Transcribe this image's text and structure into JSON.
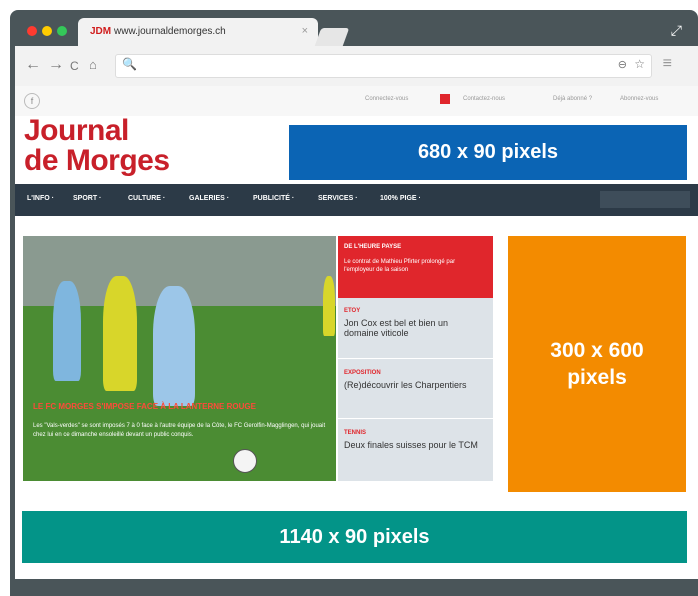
{
  "browser": {
    "tab": {
      "site_abbr": "JDM",
      "url_text": "www.journaldemorges.ch",
      "close": "×"
    },
    "nav": {
      "back": "←",
      "forward": "→",
      "reload": "C",
      "home": "⌂"
    },
    "address": {
      "search_icon": "🔍",
      "zoom_icon": "⊖",
      "star_icon": "☆"
    },
    "menu_icon": "≡",
    "expand_icon": "⤢",
    "traffic_lights": [
      "#ff3b30",
      "#ffcc00",
      "#34c759"
    ]
  },
  "site": {
    "top_links": [
      "Connectez-vous",
      "Contactez-nous",
      "Déjà abonné ?",
      "Abonnez-vous"
    ],
    "logo_line1": "Journal",
    "logo_line2": "de Morges",
    "nav_items": [
      "L'INFO ·",
      "SPORT ·",
      "CULTURE ·",
      "GALERIES ·",
      "PUBLICITÉ ·",
      "SERVICES ·",
      "100% PIGE ·"
    ],
    "hero": {
      "title": "LE FC MORGES S'IMPOSE FACE À LA LANTERNE ROUGE",
      "text": "Les \"Vals-verdes\" se sont imposés 7 à 0 face à l'autre équipe de la Côte, le FC Gerolfin-Magglingen, qui jouait chez lui en ce dimanche ensoleillé devant un public conquis."
    },
    "side": {
      "red_heading": "DE L'HEURE PAYSE",
      "red_text": "Le contrat de Mathieu Pfirter prolongé par l'employeur de la saison",
      "items": [
        {
          "kicker": "ETOY",
          "title": "Jon Cox est bel et bien un domaine viticole"
        },
        {
          "kicker": "EXPOSITION",
          "title": "(Re)découvrir les Charpentiers"
        },
        {
          "kicker": "TENNIS",
          "title": "Deux finales suisses pour le TCM"
        }
      ]
    }
  },
  "ads": {
    "top": "680 x 90 pixels",
    "side": "300 x 600 pixels",
    "bottom": "1140 x 90 pixels"
  },
  "colors": {
    "frame": "#4a5559",
    "brand_red": "#c8202a",
    "nav_bg": "#2c3a47",
    "ad_blue": "#0b64b4",
    "ad_orange": "#f38b00",
    "ad_teal": "#039488"
  }
}
